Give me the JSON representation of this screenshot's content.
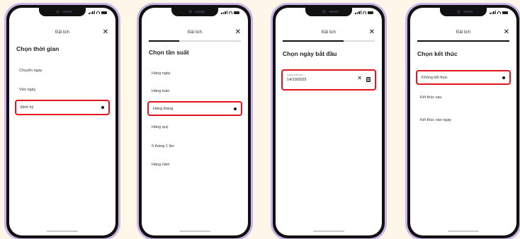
{
  "screens": [
    {
      "title": "Đặt lịch",
      "progress": null,
      "section_title": "Chọn thời gian",
      "options": [
        {
          "label": "Chuyển ngay",
          "selected": false
        },
        {
          "label": "Vào ngày",
          "selected": false
        },
        {
          "label": "Định kỳ",
          "selected": true
        }
      ]
    },
    {
      "title": "Đặt lịch",
      "progress": 0.33,
      "section_title": "Chọn tần suất",
      "options": [
        {
          "label": "Hàng ngày",
          "selected": false
        },
        {
          "label": "Hàng tuần",
          "selected": false
        },
        {
          "label": "Hàng tháng",
          "selected": true
        },
        {
          "label": "Hàng quý",
          "selected": false
        },
        {
          "label": "6 tháng 1 lần",
          "selected": false
        },
        {
          "label": "Hàng năm",
          "selected": false
        }
      ]
    },
    {
      "title": "Đặt lịch",
      "progress": 0.66,
      "section_title": "Chọn ngày bắt đầu",
      "date_field": {
        "label": "Ngày bắt đầu",
        "value": "14/10/2025"
      }
    },
    {
      "title": "Đặt lịch",
      "progress": 1.0,
      "section_title": "Chọn kết thúc",
      "options": [
        {
          "label": "Không kết thúc",
          "selected": true
        },
        {
          "label": "Kết thúc sau",
          "selected": false
        },
        {
          "label": "Kết thúc vào ngày",
          "selected": false
        }
      ]
    }
  ],
  "colors": {
    "background": "#fdf6e9",
    "phone_frame": "#c9b6e6",
    "highlight": "#e3141b"
  },
  "icons": {
    "close": "close-icon",
    "clear": "clear-icon",
    "calendar": "calendar-icon"
  }
}
